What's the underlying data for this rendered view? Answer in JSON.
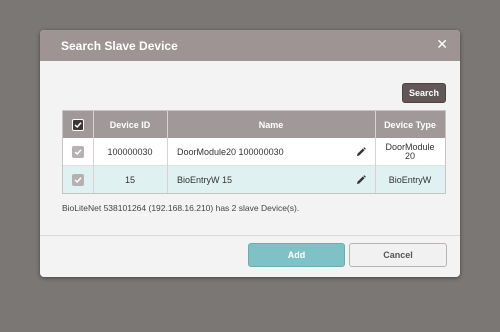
{
  "dialog": {
    "title": "Search Slave Device",
    "close_symbol": "✕"
  },
  "search_button": "Search",
  "table": {
    "headers": {
      "select": "",
      "device_id": "Device ID",
      "name": "Name",
      "device_type": "Device Type"
    },
    "rows": [
      {
        "checked": true,
        "device_id": "100000030",
        "name": "DoorModule20 100000030",
        "device_type_line1": "DoorModule",
        "device_type_line2": "20"
      },
      {
        "checked": true,
        "device_id": "15",
        "name": "BioEntryW 15",
        "device_type_line1": "BioEntryW",
        "device_type_line2": ""
      }
    ]
  },
  "status_text": "BioLiteNet 538101264 (192.168.16.210) has 2 slave Device(s).",
  "buttons": {
    "add": "Add",
    "cancel": "Cancel"
  },
  "icons": [
    "close-icon",
    "checkbox-icon",
    "pencil-icon"
  ],
  "colors": {
    "overlay": "#7b7775",
    "titlebar": "#9e9494",
    "table_header": "#a19899",
    "selected_row": "#dff2f1",
    "add_button": "#7fc2c6",
    "search_button": "#615658"
  }
}
